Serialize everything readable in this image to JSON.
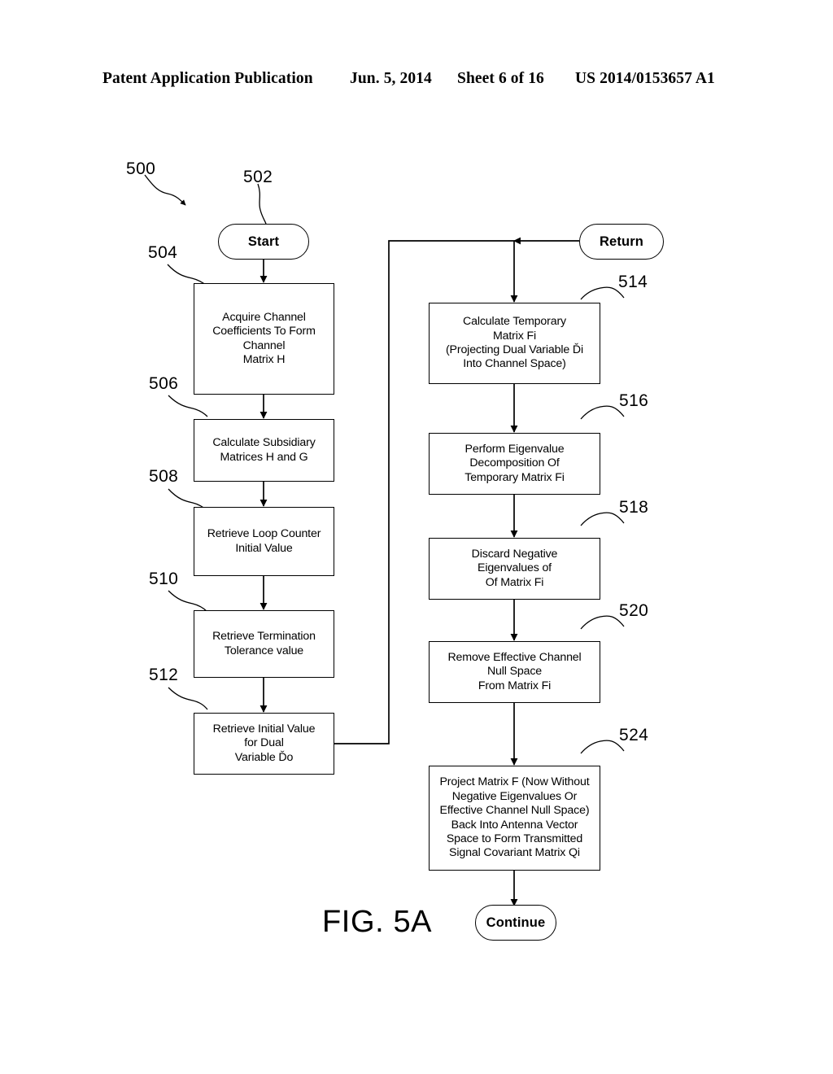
{
  "header": {
    "publication": "Patent Application Publication",
    "date": "Jun. 5, 2014",
    "sheet": "Sheet 6 of 16",
    "patent_number": "US 2014/0153657 A1"
  },
  "figure": {
    "caption": "FIG. 5A",
    "reference_numerals": {
      "flow": "500",
      "start": "502",
      "acquire_channel": "504",
      "calculate_subsidiary": "506",
      "retrieve_loop_counter": "508",
      "retrieve_termination": "510",
      "retrieve_initial_dual": "512",
      "calculate_temporary": "514",
      "perform_eigenvalue": "516",
      "discard_negative": "518",
      "remove_null_space": "520",
      "project_matrix": "524"
    },
    "terminators": {
      "start": "Start",
      "return": "Return",
      "continue": "Continue"
    },
    "steps": [
      {
        "id": "504",
        "lines": [
          "Acquire Channel",
          "Coefficients To Form",
          "Channel",
          "Matrix H"
        ]
      },
      {
        "id": "506",
        "lines": [
          "Calculate Subsidiary",
          "Matrices H and G"
        ]
      },
      {
        "id": "508",
        "lines": [
          "Retrieve Loop Counter",
          "Initial Value"
        ]
      },
      {
        "id": "510",
        "lines": [
          "Retrieve Termination",
          "Tolerance value"
        ]
      },
      {
        "id": "512",
        "lines": [
          "Retrieve Initial Value",
          "for Dual",
          "Variable Ďo"
        ]
      },
      {
        "id": "514",
        "lines": [
          "Calculate Temporary",
          "Matrix Fi",
          "(Projecting Dual Variable Ďi",
          "Into Channel Space)"
        ]
      },
      {
        "id": "516",
        "lines": [
          "Perform Eigenvalue",
          "Decomposition Of",
          "Temporary Matrix Fi"
        ]
      },
      {
        "id": "518",
        "lines": [
          "Discard Negative",
          "Eigenvalues of",
          "Of Matrix Fi"
        ]
      },
      {
        "id": "520",
        "lines": [
          "Remove Effective Channel",
          "Null Space",
          "From Matrix Fi"
        ]
      },
      {
        "id": "524",
        "lines": [
          "Project Matrix F (Now Without",
          "Negative Eigenvalues Or",
          "Effective Channel Null Space)",
          "Back Into Antenna Vector",
          "Space to Form Transmitted",
          "Signal Covariant Matrix Qi"
        ]
      }
    ]
  }
}
